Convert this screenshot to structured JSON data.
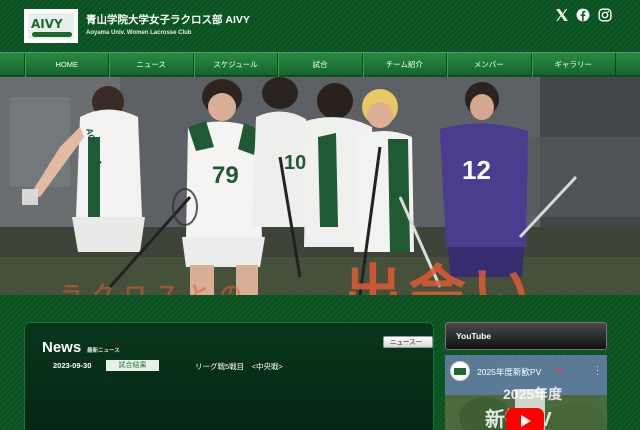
{
  "header": {
    "site_title": "青山学院大学女子ラクロス部 AIVY",
    "site_subtitle": "Aoyama Univ. Women Lacrosse Club",
    "logo_text": "AIVY"
  },
  "nav": {
    "items": [
      {
        "label": "HOME"
      },
      {
        "label": "ニュース"
      },
      {
        "label": "スケジュール"
      },
      {
        "label": "試合"
      },
      {
        "label": "チーム紹介"
      },
      {
        "label": "メンバー"
      },
      {
        "label": "ギャラリー"
      }
    ]
  },
  "hero": {
    "overlay_text": "出会い",
    "overlay_text_small": "ラクロスとの",
    "jersey_numbers": [
      "79",
      "12",
      "10"
    ],
    "jersey_text": "AOYAMA"
  },
  "news": {
    "title": "News",
    "subtitle": "最新ニュース",
    "more_label": "ニュース一覧",
    "items": [
      {
        "date": "2023-09-30",
        "category": "試合結果",
        "text": "リーグ戦5戦目　<中央戦>"
      }
    ]
  },
  "youtube": {
    "header": "YouTube",
    "video_title": "2025年度新歓PV",
    "overlay_line1": "2025年度",
    "overlay_line2": "新歓PV"
  },
  "colors": {
    "brand_green": "#0f5a26",
    "nav_green": "#2b8a44",
    "accent_red": "#e35a35",
    "youtube_red": "#ff0000"
  }
}
